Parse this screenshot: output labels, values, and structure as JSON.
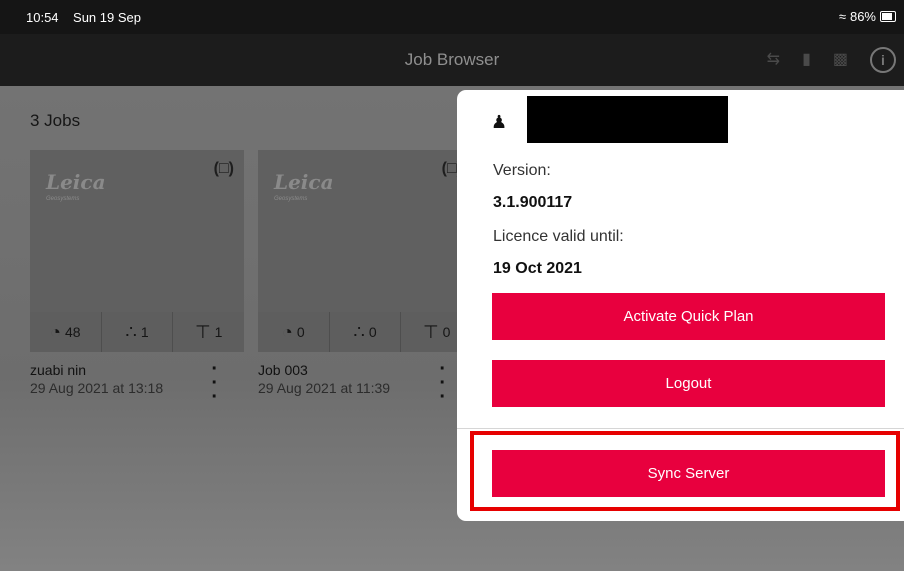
{
  "status": {
    "time": "10:54",
    "date": "Sun 19 Sep",
    "battery": "86%"
  },
  "nav": {
    "title": "Job Browser",
    "icons": [
      "transfer-icon",
      "tag-icon",
      "battery-device-icon",
      "info-icon"
    ],
    "info_glyph": "i"
  },
  "jobs": {
    "count_label": "3 Jobs",
    "cards": [
      {
        "brand": "Leica",
        "brand_sub": "Geosystems",
        "points": "48",
        "stations": "1",
        "stakeouts": "1",
        "name": "zuabi nin",
        "date": "29 Aug 2021 at 13:18"
      },
      {
        "brand": "Leica",
        "brand_sub": "Geosystems",
        "points": "0",
        "stations": "0",
        "stakeouts": "0",
        "name": "Job 003",
        "date": "29 Aug 2021 at 11:39"
      }
    ]
  },
  "popover": {
    "version_label": "Version:",
    "version_value": "3.1.900117",
    "licence_label": "Licence valid until:",
    "licence_value": "19 Oct 2021",
    "activate_label": "Activate Quick Plan",
    "logout_label": "Logout",
    "sync_label": "Sync Server"
  },
  "colors": {
    "accent": "#e8003e",
    "highlight": "#e60000"
  }
}
